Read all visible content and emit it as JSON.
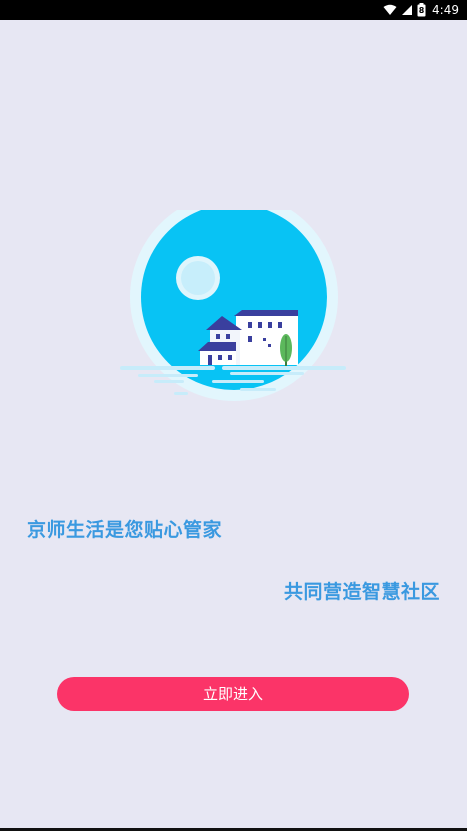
{
  "status_bar": {
    "time": "4:49",
    "battery_level": "8"
  },
  "main": {
    "slogan_line_1": "京师生活是您贴心管家",
    "slogan_line_2": "共同营造智慧社区",
    "enter_button_label": "立即进入"
  },
  "colors": {
    "background": "#e7e7f3",
    "accent_text": "#3a99e0",
    "button": "#fb3468"
  }
}
